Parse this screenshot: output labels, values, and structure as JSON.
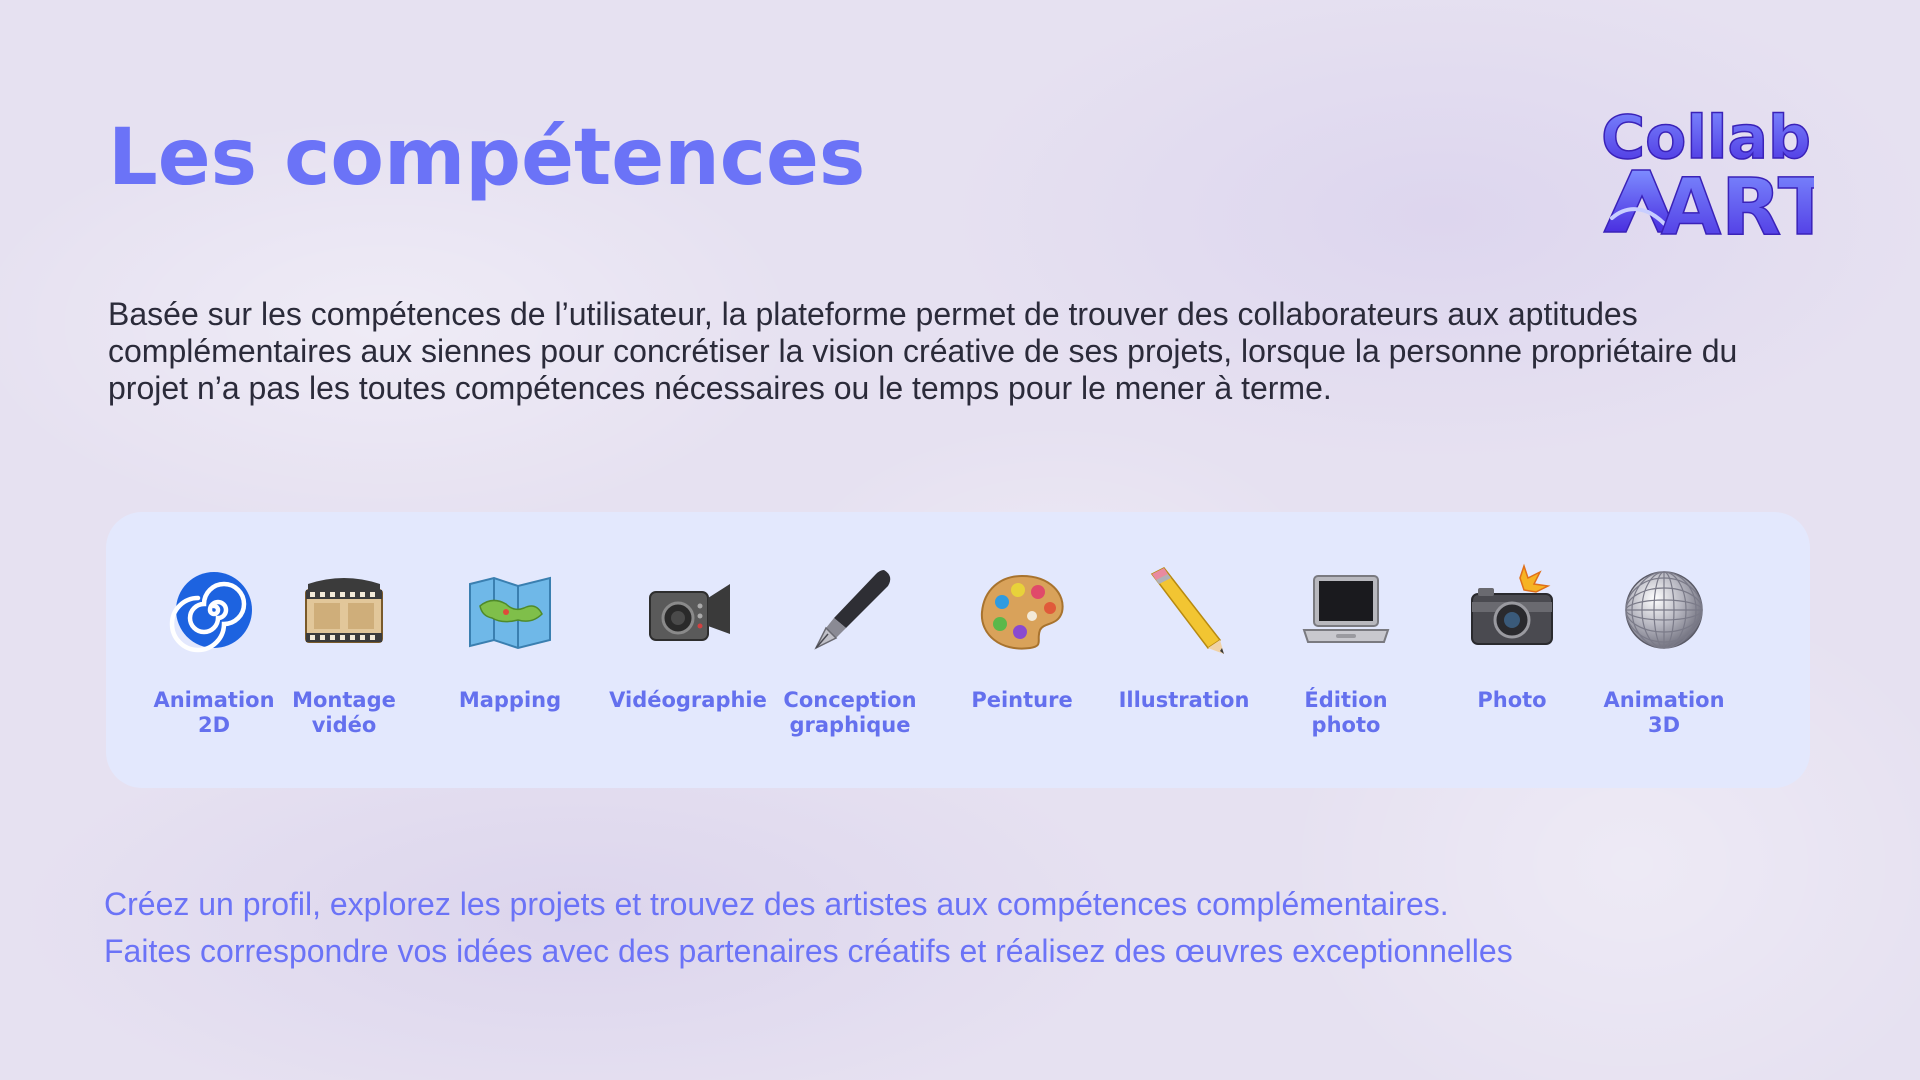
{
  "title": "Les compétences",
  "logo": {
    "line1": "Collab",
    "line2": "ART",
    "color": "#5b4ef5"
  },
  "intro": "Basée sur les compétences de l’utilisateur, la plateforme permet de trouver des collaborateurs aux aptitudes complémentaires aux siennes pour concrétiser la vision créative de ses projets, lorsque la personne propriétaire du projet n’a pas les toutes compétences nécessaires ou le temps pour le mener à terme.",
  "skills": [
    {
      "label": "Animation\n2D",
      "icon": "spiral-icon"
    },
    {
      "label": "Montage\nvidéo",
      "icon": "film-reel-icon"
    },
    {
      "label": "Mapping",
      "icon": "map-icon"
    },
    {
      "label": "Vidéographie",
      "icon": "video-camera-icon"
    },
    {
      "label": "Conception\ngraphique",
      "icon": "fountain-pen-icon"
    },
    {
      "label": "Peinture",
      "icon": "palette-icon"
    },
    {
      "label": "Illustration",
      "icon": "pencil-icon"
    },
    {
      "label": "Édition\nphoto",
      "icon": "laptop-icon"
    },
    {
      "label": "Photo",
      "icon": "camera-flash-icon"
    },
    {
      "label": "Animation 3D",
      "icon": "disco-ball-icon"
    }
  ],
  "tagline": {
    "line1": "Créez un profil, explorez les projets et trouvez des artistes aux compétences complémentaires.",
    "line2": "Faites correspondre vos idées avec des partenaires créatifs et réalisez des œuvres exceptionnelles"
  },
  "colors": {
    "accent": "#6b73f7",
    "panel": "#e3e8fd",
    "body_text": "#2b2b3a"
  }
}
